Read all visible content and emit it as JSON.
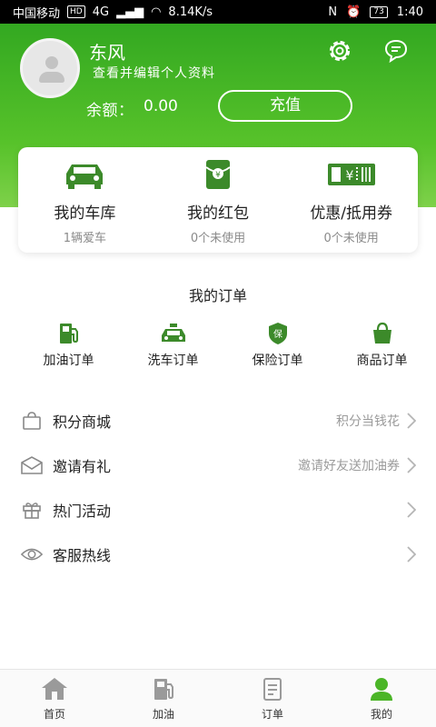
{
  "status_bar": {
    "carrier": "中国移动",
    "hd": "HD",
    "network": "4G",
    "speed": "8.14K/s",
    "battery": "73",
    "time": "1:40"
  },
  "profile": {
    "name": "东风",
    "edit_link": "查看并编辑个人资料",
    "balance_label": "余额：",
    "balance_value": "0.00",
    "recharge_label": "充值"
  },
  "wallet": [
    {
      "title": "我的车库",
      "subtitle": "1辆爱车",
      "icon": "car-icon"
    },
    {
      "title": "我的红包",
      "subtitle": "0个未使用",
      "icon": "red-envelope-icon"
    },
    {
      "title": "优惠/抵用券",
      "subtitle": "0个未使用",
      "icon": "coupon-icon"
    }
  ],
  "orders": {
    "title": "我的订单",
    "items": [
      {
        "label": "加油订单",
        "icon": "fuel-icon"
      },
      {
        "label": "洗车订单",
        "icon": "car-wash-icon"
      },
      {
        "label": "保险订单",
        "icon": "insurance-icon"
      },
      {
        "label": "商品订单",
        "icon": "shopping-bag-icon"
      }
    ]
  },
  "menu": [
    {
      "label": "积分商城",
      "hint": "积分当钱花",
      "icon": "points-mall-icon"
    },
    {
      "label": "邀请有礼",
      "hint": "邀请好友送加油券",
      "icon": "envelope-icon"
    },
    {
      "label": "热门活动",
      "hint": "",
      "icon": "gift-icon"
    },
    {
      "label": "客服热线",
      "hint": "",
      "icon": "eye-icon"
    }
  ],
  "tabbar": [
    {
      "label": "首页",
      "icon": "home-icon"
    },
    {
      "label": "加油",
      "icon": "fuel-pump-icon"
    },
    {
      "label": "订单",
      "icon": "order-icon"
    },
    {
      "label": "我的",
      "icon": "profile-icon"
    }
  ],
  "colors": {
    "brand_green": "#4bb527",
    "header_top": "#33a821",
    "header_bottom": "#7ed14a"
  }
}
